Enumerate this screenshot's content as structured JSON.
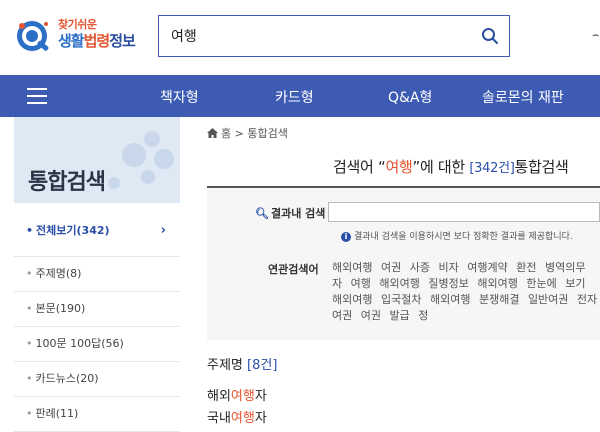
{
  "header": {
    "logo_small": "찾기쉬운",
    "logo_part1": "생활",
    "logo_part2": "법령",
    "logo_part3": "정보",
    "search_value": "여행",
    "cut_text": "⌢"
  },
  "nav": {
    "items": [
      "책자형",
      "카드형",
      "Q&A형",
      "솔로몬의 재판"
    ]
  },
  "sidebar": {
    "title": "통합검색",
    "items": [
      {
        "label": "전체보기(342)",
        "active": true
      },
      {
        "label": "주제명(8)"
      },
      {
        "label": "본문(190)"
      },
      {
        "label": "100문 100답(56)"
      },
      {
        "label": "카드뉴스(20)"
      },
      {
        "label": "판례(11)"
      }
    ]
  },
  "breadcrumb": {
    "home": "홈",
    "sep": ">",
    "current": "통합검색"
  },
  "result": {
    "prefix": "검색어 “",
    "keyword": "여행",
    "suffix": "”에 대한 ",
    "count": "[342건]",
    "tail": "통합검색"
  },
  "filter": {
    "inner_label": "결과내 검색",
    "inner_value": "",
    "note": "결과내 검색을 이용하시면 보다 정확한 결과를 제공합니다.",
    "related_label": "연관검색어",
    "related": [
      "해외여행",
      "여권",
      "사증",
      "비자",
      "여행계약",
      "환전",
      "병역의무자",
      "여행",
      "해외여행",
      "질병정보",
      "해외여행",
      "한눈에",
      "보기",
      "해외여행",
      "입국절차",
      "해외여행",
      "분쟁해결",
      "일반여권",
      "전자여권",
      "여권",
      "발급",
      "정"
    ]
  },
  "subject": {
    "label": "주제명",
    "count": "[8건]",
    "items": [
      {
        "pre": "해외",
        "hl": "여행",
        "post": "자"
      },
      {
        "pre": "국내",
        "hl": "여행",
        "post": "자"
      }
    ]
  },
  "colors": {
    "brand_blue": "#3e5bb3",
    "accent_orange": "#e4552f",
    "link_blue": "#2b50a8"
  }
}
